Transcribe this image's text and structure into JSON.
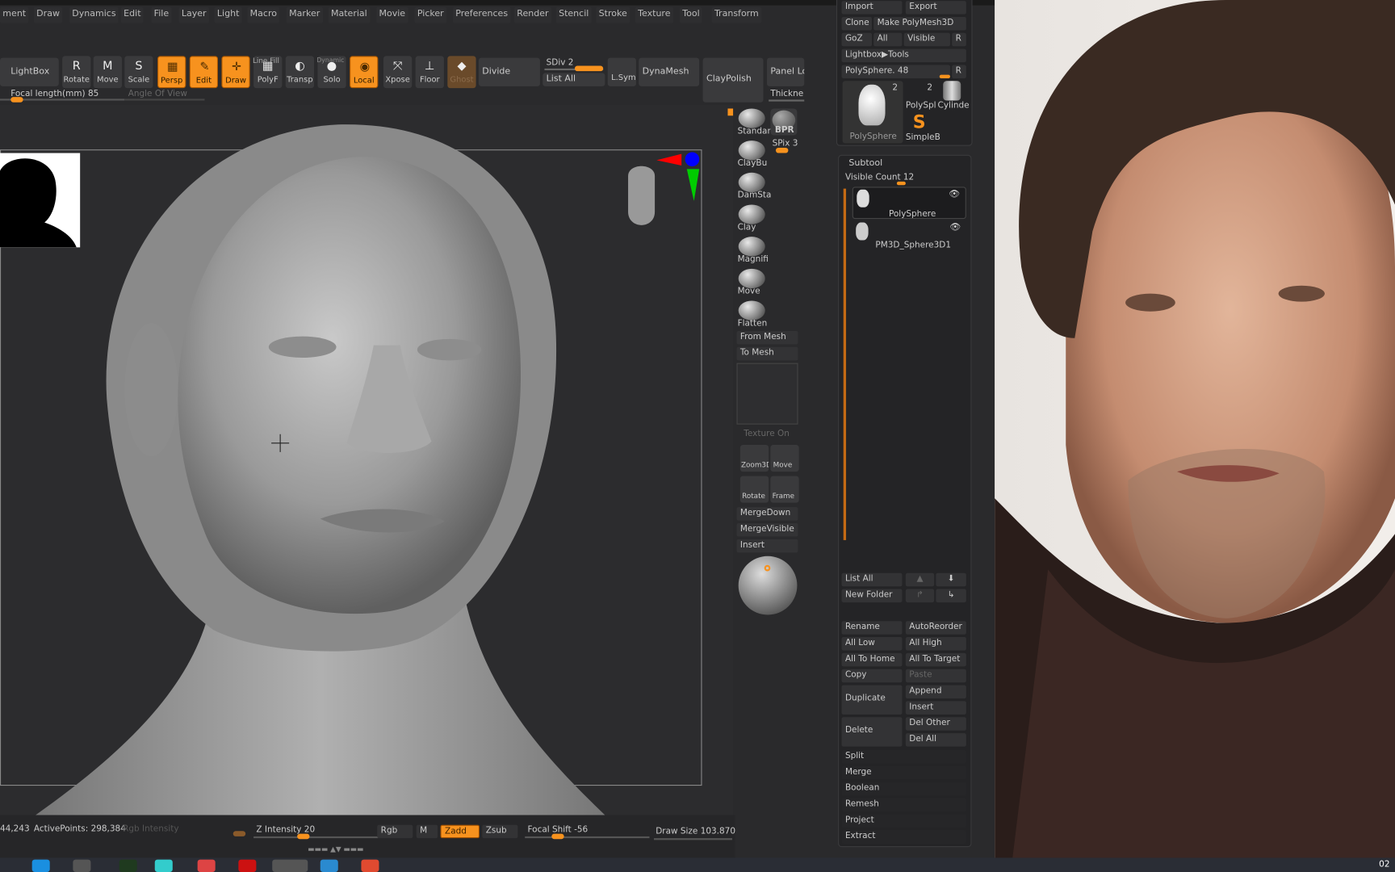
{
  "menu": [
    "ment",
    "Draw",
    "Dynamics",
    "Edit",
    "File",
    "Layer",
    "Light",
    "Macro",
    "Marker",
    "Material",
    "Movie",
    "Picker",
    "Preferences",
    "Render",
    "Stencil",
    "Stroke",
    "Texture",
    "Tool",
    "Transform"
  ],
  "toolbar": {
    "lightbox": "LightBox",
    "tools": [
      {
        "label": "Rotate",
        "icon": "R",
        "active": false
      },
      {
        "label": "Move",
        "icon": "M",
        "active": false
      },
      {
        "label": "Scale",
        "icon": "S",
        "active": false
      },
      {
        "label": "Persp",
        "icon": "▦",
        "active": true
      },
      {
        "label": "Edit",
        "icon": "✎",
        "active": true
      },
      {
        "label": "Draw",
        "icon": "✛",
        "active": true
      },
      {
        "label": "PolyF",
        "icon": "▦",
        "active": false
      },
      {
        "label": "Transp",
        "icon": "◐",
        "active": false
      },
      {
        "label": "Solo",
        "icon": "●",
        "active": false
      },
      {
        "label": "Local",
        "icon": "◉",
        "active": true
      },
      {
        "label": "Xpose",
        "icon": "⤧",
        "active": false
      },
      {
        "label": "Floor",
        "icon": "⊥",
        "active": false
      },
      {
        "label": "Ghost",
        "icon": "◆",
        "active": false
      }
    ],
    "line_fill": "Line Fill",
    "dynamic": "Dynamic",
    "divide": "Divide",
    "sdiv": "SDiv 2",
    "list_all": "List All",
    "lsym": "L.Sym",
    "dynamesh": "DynaMesh",
    "claypolish": "ClayPolish",
    "panel_loops": "Panel Lo",
    "thickness": "Thickne",
    "focal_length": "Focal length(mm) 85",
    "angle_of_view": "Angle Of View"
  },
  "brushes": [
    {
      "label": "Standar"
    },
    {
      "label": "ClayBu"
    },
    {
      "label": "DamSta"
    },
    {
      "label": "Clay"
    },
    {
      "label": "Magnifi"
    },
    {
      "label": "Move"
    },
    {
      "label": "Flatten"
    }
  ],
  "brush_panel": {
    "bpr": "BPR",
    "spix": "SPix 3",
    "from_mesh": "From Mesh",
    "to_mesh": "To Mesh",
    "texture_on": "Texture On",
    "zoom3d": "Zoom3D",
    "move": "Move",
    "rotate": "Rotate",
    "frame": "Frame",
    "merge_down": "MergeDown",
    "merge_visible": "MergeVisible",
    "insert": "Insert"
  },
  "tool_panel": {
    "import": "Import",
    "export": "Export",
    "clone": "Clone",
    "make_polymesh": "Make PolyMesh3D",
    "goz": "GoZ",
    "all": "All",
    "visible": "Visible",
    "r": "R",
    "lightbox_tools": "Lightbox▶Tools",
    "polysphere_slider": "PolySphere. 48",
    "thumbs": [
      {
        "label": "PolySphere",
        "count": "2"
      },
      {
        "label": "PolySpl",
        "count": "2"
      },
      {
        "label": "Cylinde"
      },
      {
        "label": "SimpleB"
      }
    ]
  },
  "subtool": {
    "title": "Subtool",
    "visible_count": "Visible Count 12",
    "items": [
      {
        "label": "PolySphere"
      },
      {
        "label": "PM3D_Sphere3D1"
      }
    ],
    "list_all": "List All",
    "new_folder": "New Folder",
    "buttons": [
      [
        "Rename",
        "AutoReorder"
      ],
      [
        "All Low",
        "All High"
      ],
      [
        "All To Home",
        "All To Target"
      ],
      [
        "Copy",
        "Paste"
      ]
    ],
    "duplicate": "Duplicate",
    "append": "Append",
    "insert": "Insert",
    "delete": "Delete",
    "del_other": "Del Other",
    "del_all": "Del All",
    "sections": [
      "Split",
      "Merge",
      "Boolean",
      "Remesh",
      "Project",
      "Extract"
    ]
  },
  "status": {
    "points": "44,243",
    "active_points": "ActivePoints: 298,384",
    "rgb_intensity": "Rgb Intensity",
    "z_intensity": "Z Intensity 20",
    "rgb": "Rgb",
    "m": "M",
    "zadd": "Zadd",
    "zsub": "Zsub",
    "focal_shift": "Focal Shift -56",
    "draw_size": "Draw Size 103.870"
  },
  "values": {
    "z_intensity": 20,
    "focal_shift": -56,
    "sdiv_fraction": 1.0
  },
  "clock": "02",
  "colors": {
    "accent": "#f7921e",
    "panel": "#2a2a2c",
    "button": "#3a3a3c"
  }
}
